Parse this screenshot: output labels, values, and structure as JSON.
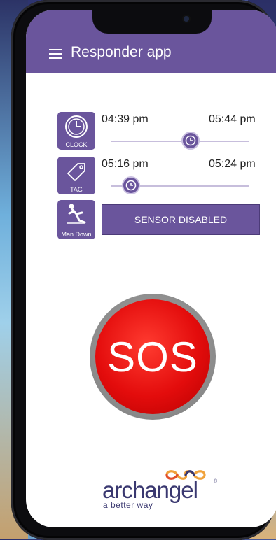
{
  "app": {
    "title": "Responder app"
  },
  "rows": [
    {
      "icon": "clock-icon",
      "label": "CLOCK",
      "start_time": "04:39 pm",
      "end_time": "05:44 pm"
    },
    {
      "icon": "tag-icon",
      "label": "TAG",
      "start_time": "05:16 pm",
      "end_time": "05:24 pm"
    },
    {
      "icon": "man-down-icon",
      "label": "Man Down",
      "button": "SENSOR DISABLED"
    }
  ],
  "sos": {
    "label": "SOS"
  },
  "logo": {
    "name": "archangel",
    "registered": "®",
    "tagline": "a better way"
  },
  "colors": {
    "primary": "#6a559c",
    "sos_red": "#e30c0c",
    "logo": "#3a3870"
  }
}
